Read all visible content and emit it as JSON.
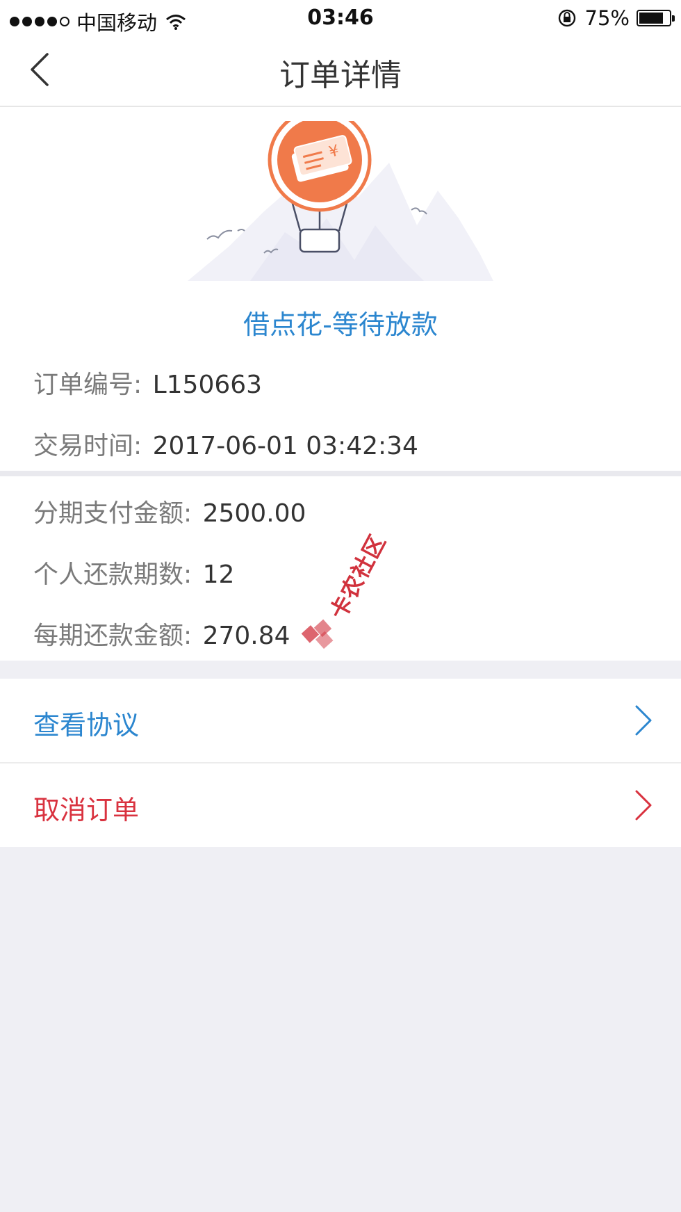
{
  "status_bar": {
    "carrier": "中国移动",
    "time": "03:46",
    "battery": "75%",
    "signal_dots": 4
  },
  "nav": {
    "title": "订单详情"
  },
  "order": {
    "status_title": "借点花-等待放款",
    "order_no_label": "订单编号:",
    "order_no_value": "L150663",
    "trade_time_label": "交易时间:",
    "trade_time_value": "2017-06-01 03:42:34"
  },
  "installment": {
    "amount_label": "分期支付金额:",
    "amount_value": "2500.00",
    "periods_label": "个人还款期数:",
    "periods_value": "12",
    "per_period_label": "每期还款金额:",
    "per_period_value": "270.84"
  },
  "actions": {
    "view_agreement": "查看协议",
    "cancel_order": "取消订单"
  },
  "watermark": {
    "text": "卡农社区"
  },
  "colors": {
    "accent_blue": "#2b86cf",
    "cancel_red": "#d9323f",
    "orange": "#f07a4a"
  },
  "icons": {
    "back": "chevron-left-icon",
    "wifi": "wifi-icon",
    "lock": "rotation-lock-icon",
    "battery": "battery-icon",
    "illustration": "hot-air-balloon-money-icon",
    "row_chevron": "chevron-right-icon"
  }
}
